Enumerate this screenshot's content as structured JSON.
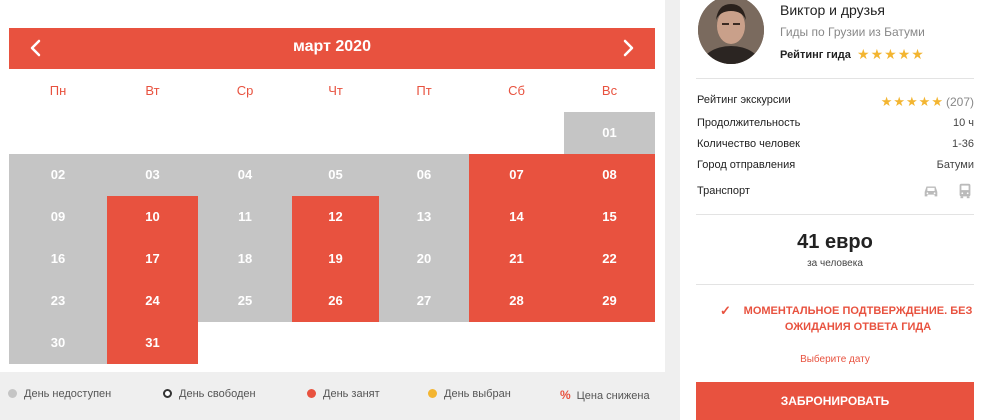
{
  "calendar": {
    "title": "март 2020",
    "weekdays": [
      "Пн",
      "Вт",
      "Ср",
      "Чт",
      "Пт",
      "Сб",
      "Вс"
    ],
    "days": [
      {
        "label": "01",
        "status": "unavailable",
        "col": 6,
        "row": 0
      },
      {
        "label": "02",
        "status": "unavailable",
        "col": 0,
        "row": 1
      },
      {
        "label": "03",
        "status": "unavailable",
        "col": 1,
        "row": 1
      },
      {
        "label": "04",
        "status": "unavailable",
        "col": 2,
        "row": 1
      },
      {
        "label": "05",
        "status": "unavailable",
        "col": 3,
        "row": 1
      },
      {
        "label": "06",
        "status": "unavailable",
        "col": 4,
        "row": 1
      },
      {
        "label": "07",
        "status": "busy",
        "col": 5,
        "row": 1
      },
      {
        "label": "08",
        "status": "busy",
        "col": 6,
        "row": 1
      },
      {
        "label": "09",
        "status": "unavailable",
        "col": 0,
        "row": 2
      },
      {
        "label": "10",
        "status": "busy",
        "col": 1,
        "row": 2
      },
      {
        "label": "11",
        "status": "unavailable",
        "col": 2,
        "row": 2
      },
      {
        "label": "12",
        "status": "busy",
        "col": 3,
        "row": 2
      },
      {
        "label": "13",
        "status": "unavailable",
        "col": 4,
        "row": 2
      },
      {
        "label": "14",
        "status": "busy",
        "col": 5,
        "row": 2
      },
      {
        "label": "15",
        "status": "busy",
        "col": 6,
        "row": 2
      },
      {
        "label": "16",
        "status": "unavailable",
        "col": 0,
        "row": 3
      },
      {
        "label": "17",
        "status": "busy",
        "col": 1,
        "row": 3
      },
      {
        "label": "18",
        "status": "unavailable",
        "col": 2,
        "row": 3
      },
      {
        "label": "19",
        "status": "busy",
        "col": 3,
        "row": 3
      },
      {
        "label": "20",
        "status": "unavailable",
        "col": 4,
        "row": 3
      },
      {
        "label": "21",
        "status": "busy",
        "col": 5,
        "row": 3
      },
      {
        "label": "22",
        "status": "busy",
        "col": 6,
        "row": 3
      },
      {
        "label": "23",
        "status": "unavailable",
        "col": 0,
        "row": 4
      },
      {
        "label": "24",
        "status": "busy",
        "col": 1,
        "row": 4
      },
      {
        "label": "25",
        "status": "unavailable",
        "col": 2,
        "row": 4
      },
      {
        "label": "26",
        "status": "busy",
        "col": 3,
        "row": 4
      },
      {
        "label": "27",
        "status": "unavailable",
        "col": 4,
        "row": 4
      },
      {
        "label": "28",
        "status": "busy",
        "col": 5,
        "row": 4
      },
      {
        "label": "29",
        "status": "busy",
        "col": 6,
        "row": 4
      },
      {
        "label": "30",
        "status": "unavailable",
        "col": 0,
        "row": 5
      },
      {
        "label": "31",
        "status": "busy",
        "col": 1,
        "row": 5
      }
    ]
  },
  "legend": {
    "unavailable": "День недоступен",
    "free": "День свободен",
    "busy": "День занят",
    "selected": "День выбран",
    "discount_symbol": "%",
    "discount": "Цена снижена"
  },
  "guide": {
    "name": "Виктор и друзья",
    "subtitle": "Гиды по Грузии из Батуми",
    "rating_label": "Рейтинг гида",
    "rating_stars": 5
  },
  "tour": {
    "rating_label": "Рейтинг экскурсии",
    "rating_stars": 5,
    "rating_count": "(207)",
    "duration_label": "Продолжительность",
    "duration_value": "10 ч",
    "people_label": "Количество человек",
    "people_value": "1-36",
    "city_label": "Город отправления",
    "city_value": "Батуми",
    "transport_label": "Транспорт",
    "transport_icons": [
      "car-icon",
      "bus-icon"
    ]
  },
  "price": {
    "amount": "41 евро",
    "per": "за человека"
  },
  "confirmation": {
    "text": "МОМЕНТАЛЬНОЕ ПОДТВЕРЖДЕНИЕ. БЕЗ ОЖИДАНИЯ ОТВЕТА ГИДА"
  },
  "choose_date": "Выберите дату",
  "book_button": "ЗАБРОНИРОВАТЬ",
  "colors": {
    "accent": "#e8523f",
    "unavailable": "#c5c5c5",
    "star": "#f3b531"
  }
}
